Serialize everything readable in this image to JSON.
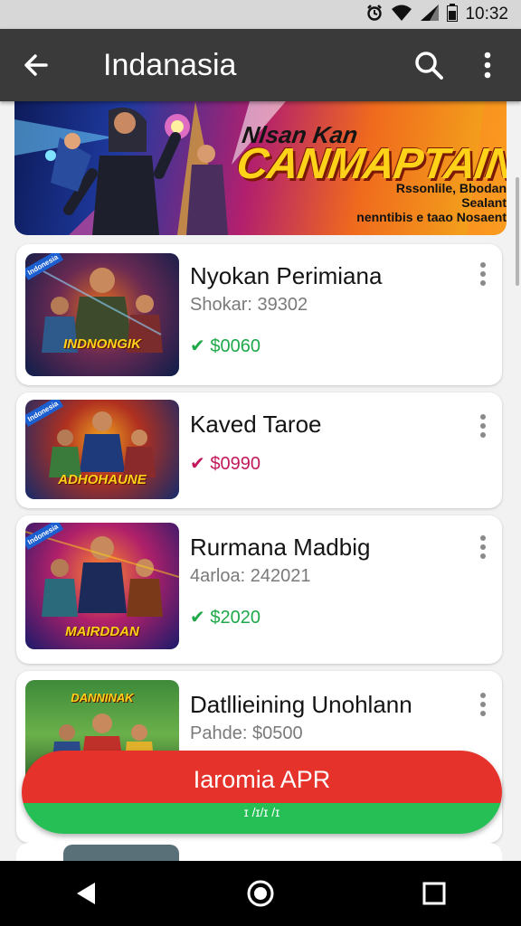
{
  "status_bar": {
    "time": "10:32",
    "icons": [
      "alarm-icon",
      "wifi-icon",
      "signal-icon",
      "battery-icon"
    ]
  },
  "app_bar": {
    "title": "Indanasia",
    "icons": [
      "back-arrow-icon",
      "search-icon",
      "more-vert-icon"
    ]
  },
  "banner": {
    "tagline": "Nlsan Kan",
    "headline": "CANMAPTAIN!",
    "subtitle_line1": "Rssonlile, Bbodan Sealant",
    "subtitle_line2": "nenntibis e taao Nosaent"
  },
  "games": [
    {
      "title": "Nyokan Perimiana",
      "subtitle": "Shokar: 39302",
      "price": "$0060",
      "price_status": "up",
      "thumb_label": "INDNONGIK",
      "thumb_badge": "Indonesia"
    },
    {
      "title": "Kaved Taroe",
      "subtitle": "",
      "price": "$0990",
      "price_status": "down",
      "thumb_label": "ADHOHAUNE",
      "thumb_badge": "Indonesia"
    },
    {
      "title": "Rurmana Madbig",
      "subtitle": "4arloa: 242021",
      "price": "$2020",
      "price_status": "up",
      "thumb_label": "MAIRDDAN",
      "thumb_badge": "Indonesia"
    },
    {
      "title": "Datllieining Unohlann",
      "subtitle": "Pahde: $0500",
      "price": "",
      "price_status": "",
      "thumb_label": "DANNINAK",
      "thumb_badge": ""
    }
  ],
  "cta": {
    "label": "Iaromia APR",
    "sublabel": "ɪ /ɪ/ɪ /ɪ"
  },
  "colors": {
    "app_bar": "#3a3a3a",
    "cta_red": "#e5322b",
    "cta_green": "#25bf55",
    "price_green": "#1fa84a",
    "price_red": "#c2185b"
  },
  "nav": {
    "icons": [
      "back-triangle-icon",
      "home-circle-icon",
      "recents-square-icon"
    ]
  }
}
